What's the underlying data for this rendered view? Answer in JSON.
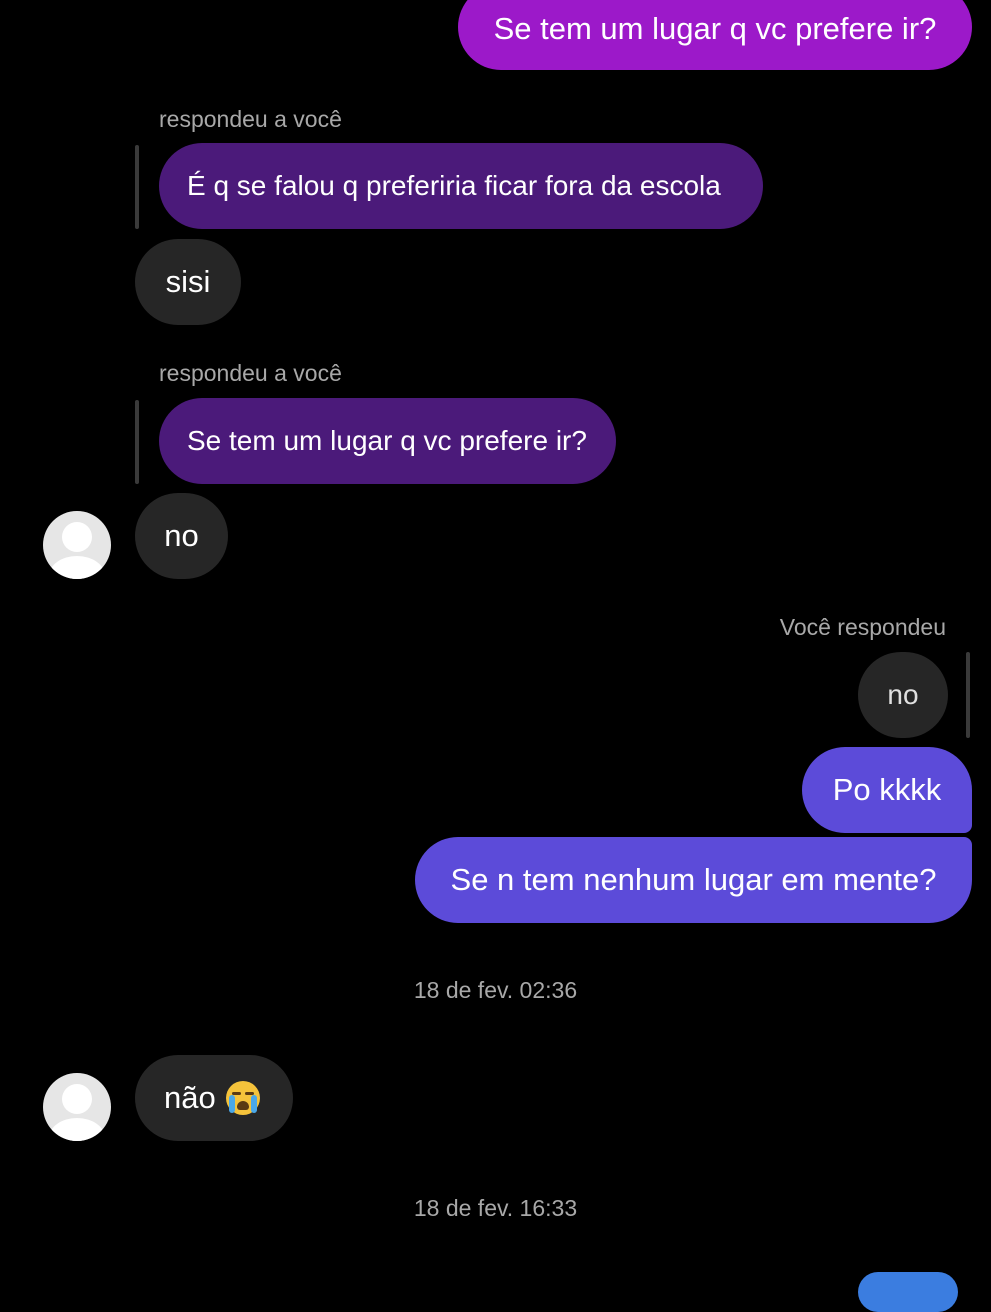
{
  "colors": {
    "background": "#000000",
    "sent_magenta": "#9c19c9",
    "sent_blue": "#5c4bd9",
    "quoted_purple": "#4b1a7a",
    "received_gray": "#262626",
    "meta_text": "#a8a8a8"
  },
  "messages": {
    "sent_top": "Se tem um lugar q vc prefere ir?",
    "reply1_label": "respondeu a você",
    "reply1_quote": "É q se falou q preferiria ficar fora da escola",
    "recv_sisi": "sisi",
    "reply2_label": "respondeu a você",
    "reply2_quote": "Se tem um lugar q vc prefere ir?",
    "recv_no": "no",
    "my_reply_label": "Você respondeu",
    "my_reply_quote": "no",
    "sent_pokkkk": "Po kkkk",
    "sent_nenhum": "Se n tem nenhum lugar em mente?",
    "timestamp1": "18 de fev. 02:36",
    "recv_nao": "não",
    "recv_nao_emoji": "loudly-crying-face-emoji",
    "timestamp2": "18 de fev. 16:33"
  },
  "avatar_icon": "default-user-avatar-icon"
}
